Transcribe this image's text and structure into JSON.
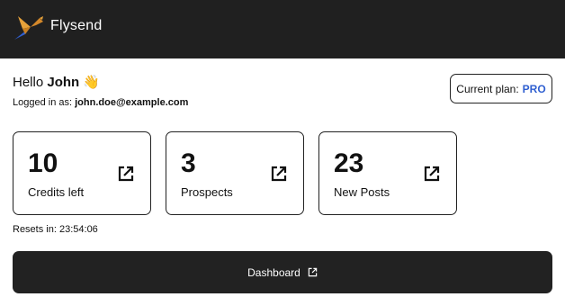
{
  "header": {
    "brand": "Flysend",
    "logo_icon": "bird-logo-icon",
    "background": "#202020"
  },
  "greeting": {
    "prefix": "Hello",
    "name": "John",
    "emoji": "👋"
  },
  "account": {
    "logged_label": "Logged in as:",
    "email": "john.doe@example.com"
  },
  "plan": {
    "label": "Current plan:",
    "tier": "PRO",
    "tier_color": "#2f5fd0"
  },
  "stats": [
    {
      "value": "10",
      "label": "Credits left",
      "icon": "external-link-icon"
    },
    {
      "value": "3",
      "label": "Prospects",
      "icon": "external-link-icon"
    },
    {
      "value": "23",
      "label": "New Posts",
      "icon": "external-link-icon"
    }
  ],
  "resets": {
    "label": "Resets in:",
    "time": "23:54:06"
  },
  "dashboard_button": {
    "label": "Dashboard",
    "icon": "external-link-icon"
  }
}
